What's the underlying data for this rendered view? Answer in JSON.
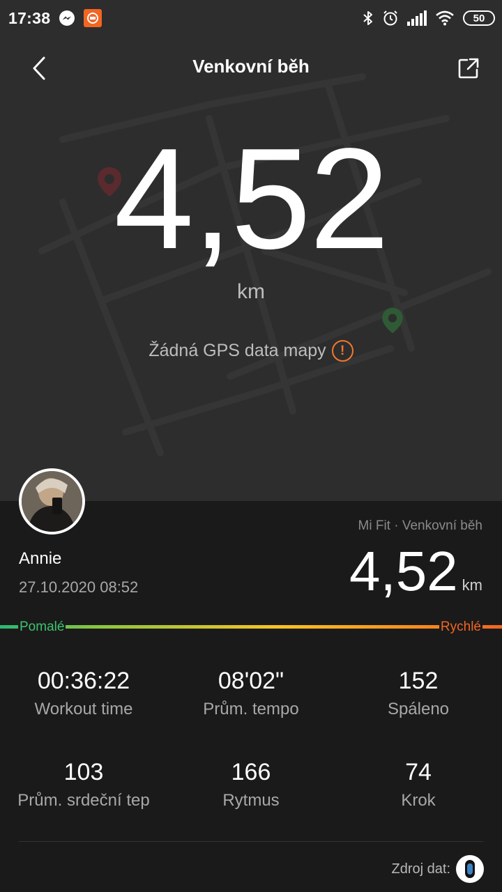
{
  "status_bar": {
    "time": "17:38",
    "battery": "50",
    "icons": [
      "messenger-icon",
      "mi-app-icon",
      "bluetooth-icon",
      "alarm-icon",
      "signal-icon",
      "wifi-icon",
      "battery-icon"
    ]
  },
  "header": {
    "title": "Venkovní běh",
    "back_icon": "chevron-left-icon",
    "share_icon": "share-icon"
  },
  "hero": {
    "distance": "4,52",
    "unit": "km",
    "gps_note": "Žádná GPS data mapy",
    "warning_symbol": "!"
  },
  "colors": {
    "background": "#1a1a1a",
    "map_background": "#2d2d2d",
    "accent_orange": "#f26522",
    "slow_green": "#3cc46f",
    "start_pin": "#5a2a2e",
    "end_pin": "#2f5a36"
  },
  "user": {
    "name": "Annie",
    "date": "27.10.2020 08:52"
  },
  "summary": {
    "source": "Mi Fit · Venkovní běh",
    "distance": "4,52",
    "unit": "km"
  },
  "pace_scale": {
    "slow_label": "Pomalé",
    "fast_label": "Rychlé"
  },
  "stats": [
    {
      "value": "00:36:22",
      "label": "Workout time"
    },
    {
      "value": "08'02\"",
      "label": "Prům. tempo"
    },
    {
      "value": "152",
      "label": "Spáleno"
    },
    {
      "value": "103",
      "label": "Prům. srdeční tep"
    },
    {
      "value": "166",
      "label": "Rytmus"
    },
    {
      "value": "74",
      "label": "Krok"
    }
  ],
  "footer": {
    "data_source_label": "Zdroj dat:"
  }
}
